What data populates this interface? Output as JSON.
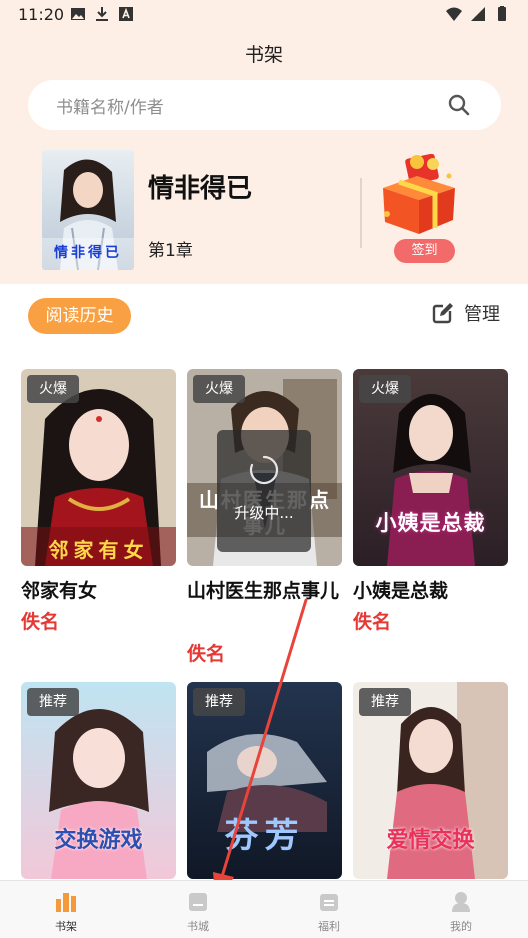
{
  "status_bar": {
    "time": "11:20"
  },
  "header": {
    "title": "书架"
  },
  "search": {
    "placeholder": "书籍名称/作者"
  },
  "current_reading": {
    "title": "情非得已",
    "chapter": "第1章",
    "cover_text": "情非得已"
  },
  "checkin": {
    "label": "签到"
  },
  "history": {
    "label": "阅读历史"
  },
  "manage": {
    "label": "管理"
  },
  "loading": {
    "text": "升级中..."
  },
  "books": [
    {
      "tag": "火爆",
      "title": "邻家有女",
      "author": "佚名",
      "cover_text": "邻家有女"
    },
    {
      "tag": "火爆",
      "title": "山村医生那点事儿",
      "author": "佚名",
      "cover_text": "山村医生那点事儿"
    },
    {
      "tag": "火爆",
      "title": "小姨是总裁",
      "author": "佚名",
      "cover_text": "小姨是总裁"
    },
    {
      "tag": "推荐",
      "title": "",
      "author": "",
      "cover_text": "交换游戏"
    },
    {
      "tag": "推荐",
      "title": "",
      "author": "",
      "cover_text": "芬芳"
    },
    {
      "tag": "推荐",
      "title": "",
      "author": "",
      "cover_text": "爱情交换"
    }
  ],
  "bottom_nav": [
    {
      "label": "书架",
      "icon": "bookshelf-icon",
      "active": true
    },
    {
      "label": "书城",
      "icon": "bookstore-icon",
      "active": false
    },
    {
      "label": "福利",
      "icon": "welfare-icon",
      "active": false
    },
    {
      "label": "我的",
      "icon": "profile-icon",
      "active": false
    }
  ],
  "colors": {
    "header_bg": "#fdefe5",
    "accent_orange": "#f8a042",
    "author_red": "#e53935",
    "checkin_red": "#f26a6a",
    "arrow_red": "#e8443a"
  }
}
